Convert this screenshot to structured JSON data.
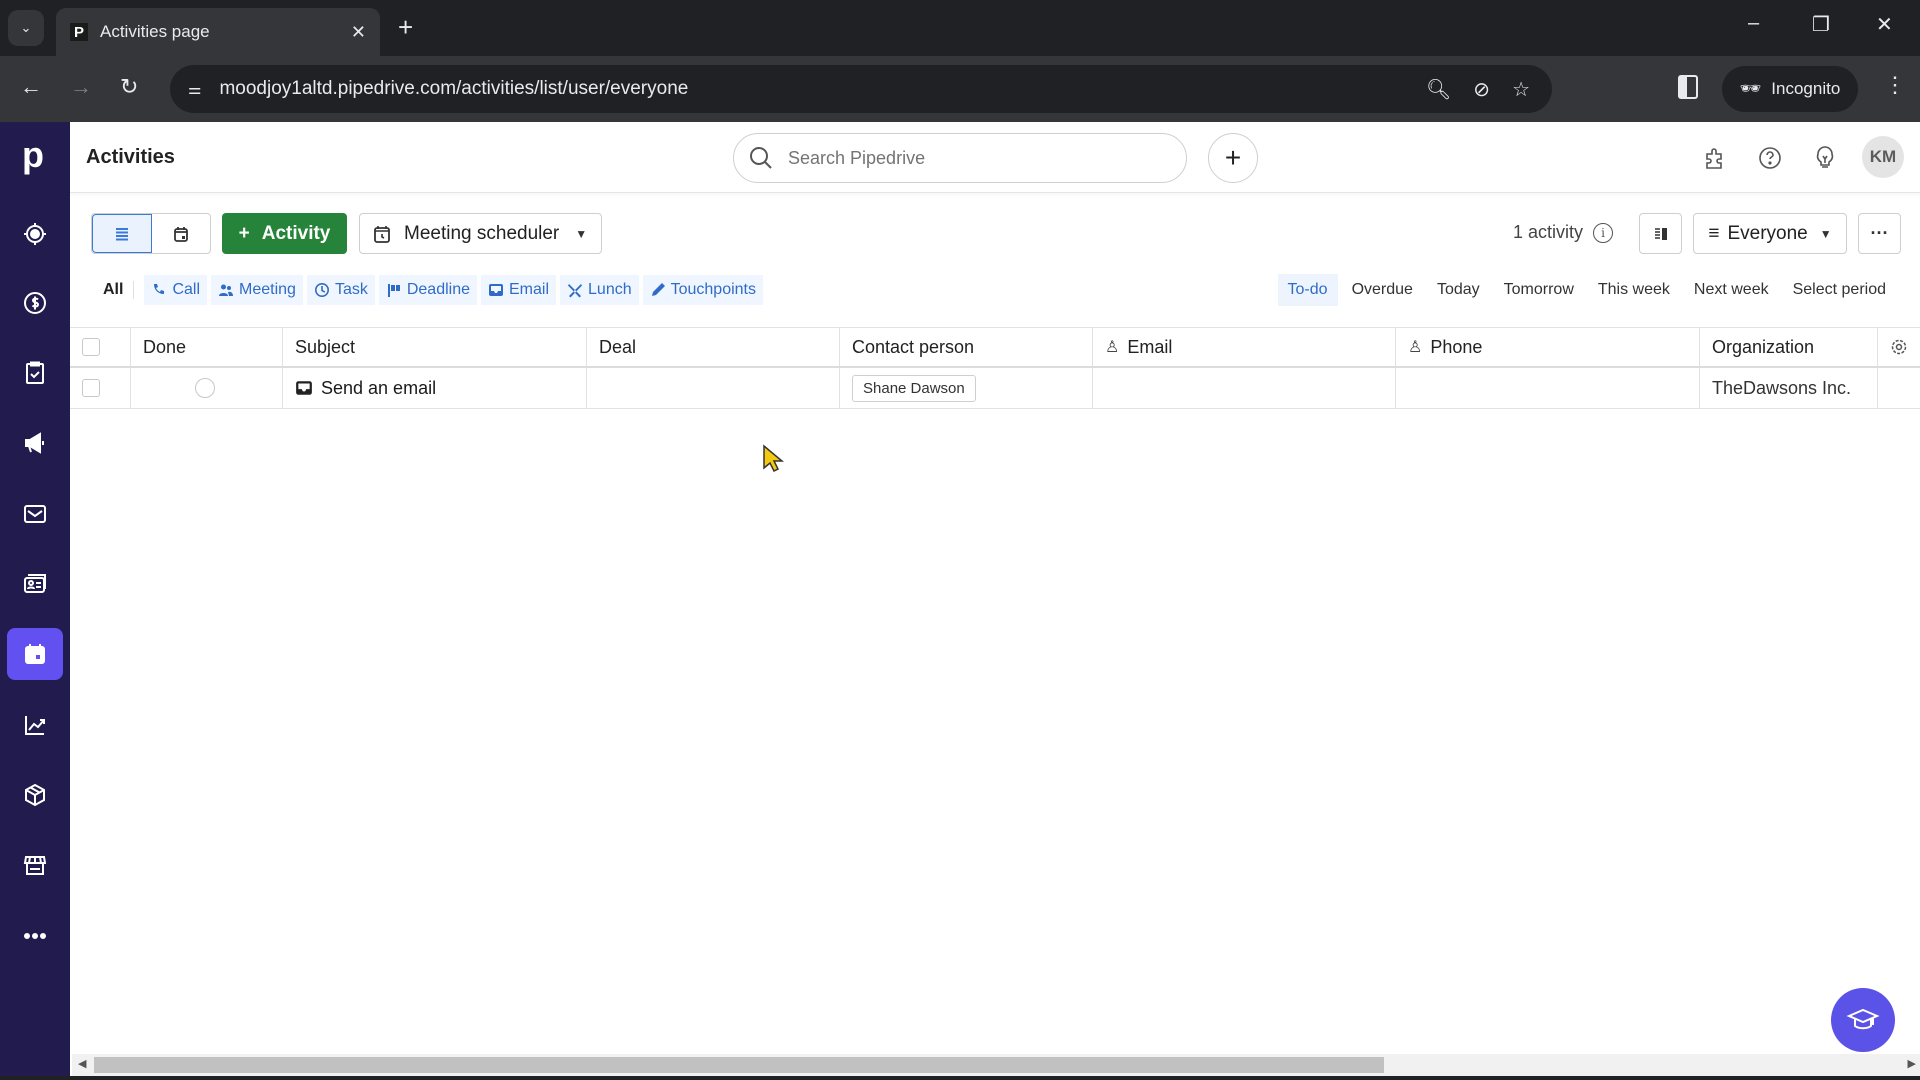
{
  "browser": {
    "tab_title": "Activities page",
    "favicon_letter": "P",
    "url": "moodjoy1altd.pipedrive.com/activities/list/user/everyone",
    "incognito_label": "Incognito"
  },
  "sidebar": {
    "logo": "p",
    "items": [
      {
        "name": "leads",
        "icon": "target-icon",
        "active": false
      },
      {
        "name": "deals",
        "icon": "dollar-icon",
        "active": false
      },
      {
        "name": "projects",
        "icon": "clipboard-check-icon",
        "active": false
      },
      {
        "name": "campaigns",
        "icon": "megaphone-icon",
        "active": false
      },
      {
        "name": "mail",
        "icon": "envelope-icon",
        "active": false
      },
      {
        "name": "contacts",
        "icon": "contact-card-icon",
        "active": true
      },
      {
        "name": "activities",
        "icon": "calendar-icon",
        "active": true
      },
      {
        "name": "insights",
        "icon": "chart-icon",
        "active": false
      },
      {
        "name": "products",
        "icon": "box-icon",
        "active": false
      },
      {
        "name": "marketplace",
        "icon": "store-icon",
        "active": false
      },
      {
        "name": "more",
        "icon": "more-icon",
        "active": false
      }
    ]
  },
  "header": {
    "title": "Activities",
    "search_placeholder": "Search Pipedrive",
    "avatar_initials": "KM"
  },
  "toolbar": {
    "add_activity_label": "Activity",
    "meeting_scheduler_label": "Meeting scheduler",
    "activity_count": "1 activity",
    "owner_filter_label": "Everyone",
    "more_label": "···"
  },
  "type_filters": {
    "all_label": "All",
    "items": [
      "Call",
      "Meeting",
      "Task",
      "Deadline",
      "Email",
      "Lunch",
      "Touchpoints"
    ]
  },
  "period_filters": {
    "selected": "To-do",
    "items": [
      "To-do",
      "Overdue",
      "Today",
      "Tomorrow",
      "This week",
      "Next week",
      "Select period"
    ]
  },
  "table": {
    "columns": [
      "Done",
      "Subject",
      "Deal",
      "Contact person",
      "Email",
      "Phone",
      "Organization"
    ],
    "rows": [
      {
        "done": false,
        "subject": "Send an email",
        "deal": "",
        "contact_person": "Shane Dawson",
        "email": "",
        "phone": "",
        "organization": "TheDawsons Inc."
      }
    ]
  },
  "colors": {
    "sidebar_bg": "#211b4e",
    "sidebar_active": "#6350f0",
    "primary_green": "#258439",
    "link_blue": "#2f6cc7",
    "academy_button": "#5b52e8"
  }
}
